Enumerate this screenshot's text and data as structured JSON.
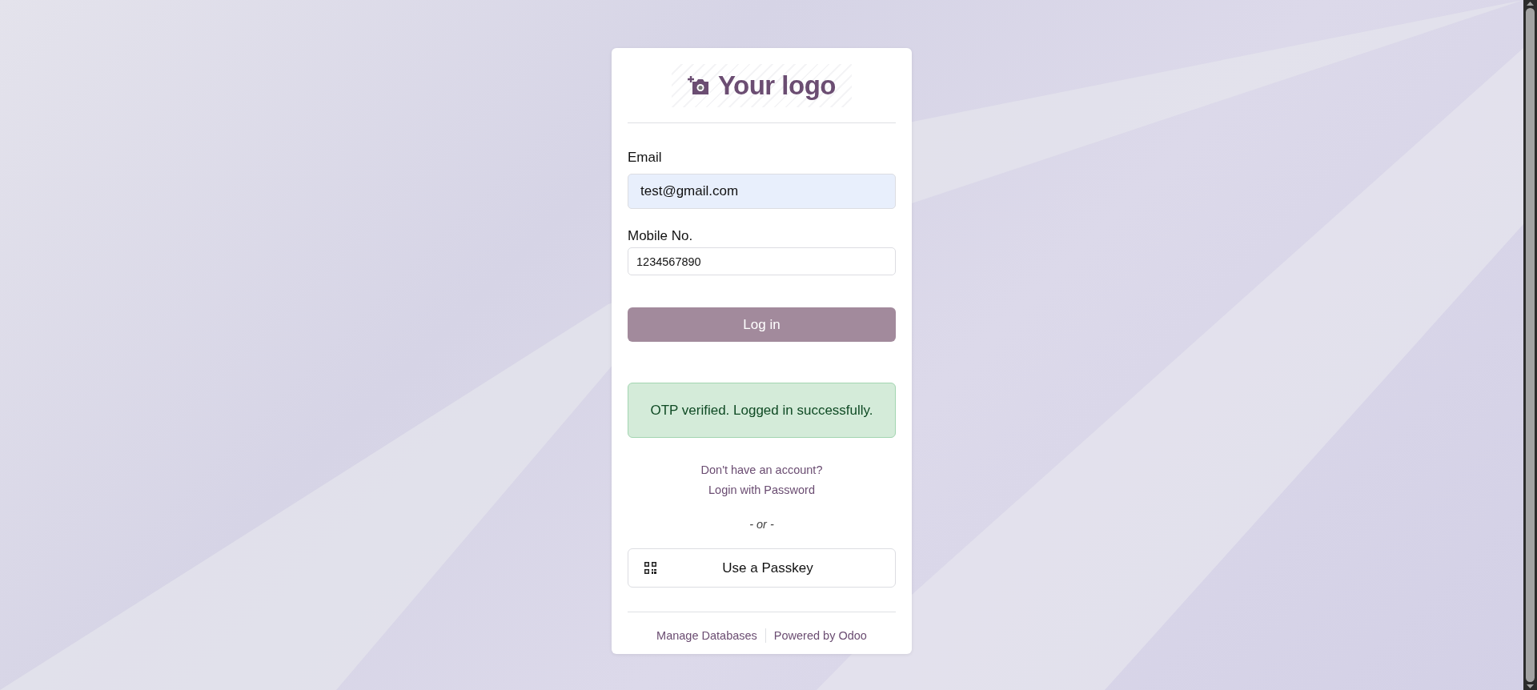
{
  "logo": {
    "text": "Your logo"
  },
  "fields": [
    {
      "label": "Email",
      "value": "test@gmail.com",
      "autofilled": true
    },
    {
      "label": "Mobile No.",
      "value": "1234567890",
      "autofilled": false
    }
  ],
  "login_button": {
    "label": "Log in",
    "disabled": true
  },
  "alert": {
    "text": "OTP verified. Logged in successfully."
  },
  "links": [
    "Don't have an account?",
    "Login with Password"
  ],
  "separator": "- or -",
  "passkey_button": {
    "label": "Use a Passkey"
  },
  "footer_links": [
    "Manage Databases",
    "Powered by Odoo"
  ]
}
